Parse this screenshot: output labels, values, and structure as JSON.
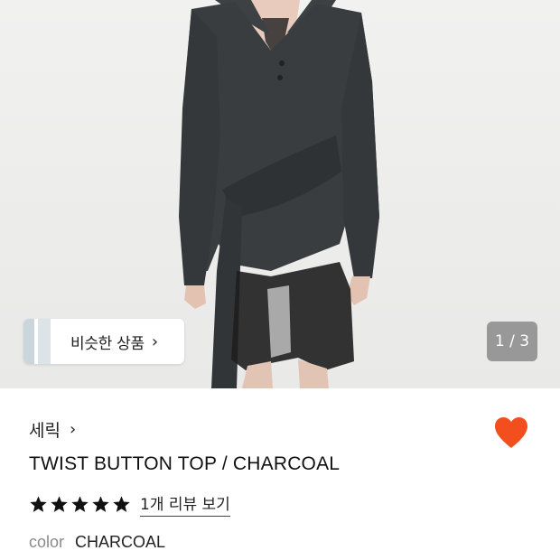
{
  "gallery": {
    "pager_text": "1 / 3",
    "similar_button_label": "비슷한 상품",
    "similar_chevron": "›"
  },
  "product": {
    "brand": "세릭",
    "brand_chevron": "›",
    "title": "TWIST BUTTON TOP / CHARCOAL",
    "rating": 5,
    "rating_max": 5,
    "review_link_text": "1개 리뷰 보기",
    "color_label": "color",
    "color_value": "CHARCOAL",
    "liked": true
  },
  "colors": {
    "heart": "#f24e1e",
    "garment": "#3a3d3f",
    "background": "#efefee"
  },
  "icons": [
    "heart-icon",
    "star-icon",
    "chevron-right-icon"
  ]
}
